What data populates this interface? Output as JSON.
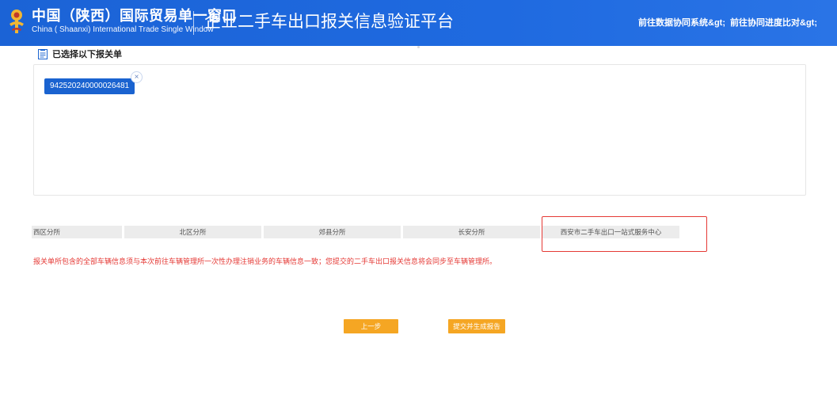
{
  "header": {
    "brand_cn": "中国（陕西）国际贸易单一窗口",
    "brand_en": "China ( Shaanxi) International Trade Single Window",
    "platform_title": "企业二手车出口报关信息验证平台",
    "nav_links": [
      {
        "label": "前往数据协同系统&gt;"
      },
      {
        "label": "前往协同进度比对&gt;"
      }
    ],
    "colors": {
      "bar": "#1f6ae0",
      "emblem_gold": "#f2b632",
      "emblem_red": "#c0392b"
    }
  },
  "section": {
    "title": "已选择以下报关单",
    "icon": "document-icon"
  },
  "selected": {
    "tags": [
      {
        "label": "942520240000026481",
        "close_glyph": "×"
      }
    ]
  },
  "offices": [
    {
      "label": "西区分所"
    },
    {
      "label": "北区分所"
    },
    {
      "label": "郊县分所"
    },
    {
      "label": "长安分所"
    },
    {
      "label": "西安市二手车出口一站式服务中心"
    }
  ],
  "notice": "报关单所包含的全部车辆信息须与本次前往车辆管理所一次性办理注销业务的车辆信息一致；您提交的二手车出口报关信息将会同步至车辆管理所。",
  "buttons": {
    "prev": "上一步",
    "submit": "提交并生成报告"
  },
  "colors": {
    "accent": "#1a63d0",
    "warning": "#e53935",
    "action": "#f5a623"
  }
}
